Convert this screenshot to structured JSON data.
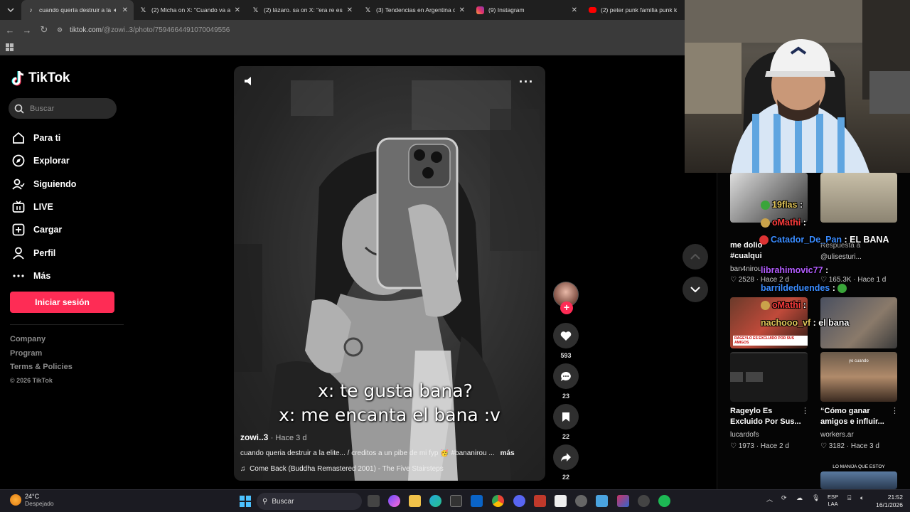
{
  "browser": {
    "tabs": [
      {
        "title": "cuando quería destruir a la",
        "favicon": "tiktok-icon",
        "active": true,
        "audio": true
      },
      {
        "title": "(2) Micha on X: \"Cuando va a se",
        "favicon": "x-icon"
      },
      {
        "title": "(2) lázaro. sa on X: \"era re espe",
        "favicon": "x-icon"
      },
      {
        "title": "(3) Tendencias en Argentina on",
        "favicon": "x-icon"
      },
      {
        "title": "(9) Instagram",
        "favicon": "instagram-icon"
      },
      {
        "title": "(2) peter punk familia punk kar",
        "favicon": "youtube-icon"
      }
    ],
    "url_host": "tiktok.com",
    "url_path": "/@zowi..3/photo/7594664491070049556"
  },
  "tiktok": {
    "brand": "TikTok",
    "search_placeholder": "Buscar",
    "menu": [
      {
        "label": "Para ti",
        "icon": "home-icon"
      },
      {
        "label": "Explorar",
        "icon": "compass-icon"
      },
      {
        "label": "Siguiendo",
        "icon": "following-icon"
      },
      {
        "label": "LIVE",
        "icon": "live-icon"
      },
      {
        "label": "Cargar",
        "icon": "upload-icon"
      },
      {
        "label": "Perfil",
        "icon": "profile-icon"
      },
      {
        "label": "Más",
        "icon": "more-icon"
      }
    ],
    "login_label": "Iniciar sesión",
    "footer": [
      "Company",
      "Program",
      "Terms & Policies"
    ],
    "copyright": "© 2026 TikTok"
  },
  "post": {
    "caption_line1": "x: te gusta bana?",
    "caption_line2": "x: me encanta el bana :v",
    "author": "zowi..3",
    "time": "· Hace 3 d",
    "description": "cuando queria destruir a la elite... / creditos a un pibe de mi fyp 🥳 #bananirou ...",
    "more_label": "más",
    "music": "Come Back (Buddha Remastered 2001) - The Five Stairsteps",
    "likes": "593",
    "comments": "23",
    "saves": "22",
    "shares": "22"
  },
  "recommendations": [
    {
      "title": "Rageylo Es Excluido Por Sus...",
      "user": "lucardofs",
      "likes": "1973",
      "time": "· Hace 2 d"
    },
    {
      "title": "“Cómo ganar amigos e influir...",
      "user": "workers.ar",
      "likes": "3182",
      "time": "· Hace 3 d"
    }
  ],
  "partial_cards": [
    {
      "title": "me dolio",
      "sub": "#cualqui",
      "user": "ban4nirou",
      "likes": "2528",
      "time": "· Hace 2 d"
    },
    {
      "respuesta": "Respuesta a",
      "user": "@ulisesturi...",
      "likes": "165.3K",
      "time": "· Hace 1 d"
    }
  ],
  "thumb_text": {
    "rageylo_banner": "RAGEYLO ES EXCLUIDO POR SUS AMIGOS",
    "yo_cuando": "yo cuando",
    "lo_manija": "LO MANIJA QUE ESTOY"
  },
  "stream_chat": [
    {
      "user": "19flas",
      "msg": "",
      "color": "yellow"
    },
    {
      "user": "oMathi",
      "msg": "",
      "color": "red"
    },
    {
      "user": "Catador_De_Pan",
      "msg": "EL BANA",
      "color": "blue"
    },
    {
      "user": "librahimovic77",
      "msg": "",
      "color": "purple"
    },
    {
      "user": "barrildeduendes",
      "msg": "",
      "color": "blue"
    },
    {
      "user": "oMathi",
      "msg": "",
      "color": "red"
    },
    {
      "user": "nachooo_vf",
      "msg": "el bana",
      "color": "yellow"
    }
  ],
  "taskbar": {
    "temp": "24°C",
    "weather": "Despejado",
    "search": "Buscar",
    "lang1": "ESP",
    "lang2": "LAA",
    "time": "21:52",
    "date": "16/1/2026"
  },
  "colors": {
    "accent": "#fe2c55",
    "background": "#000000",
    "sidebar_search": "#2a2a2a"
  }
}
